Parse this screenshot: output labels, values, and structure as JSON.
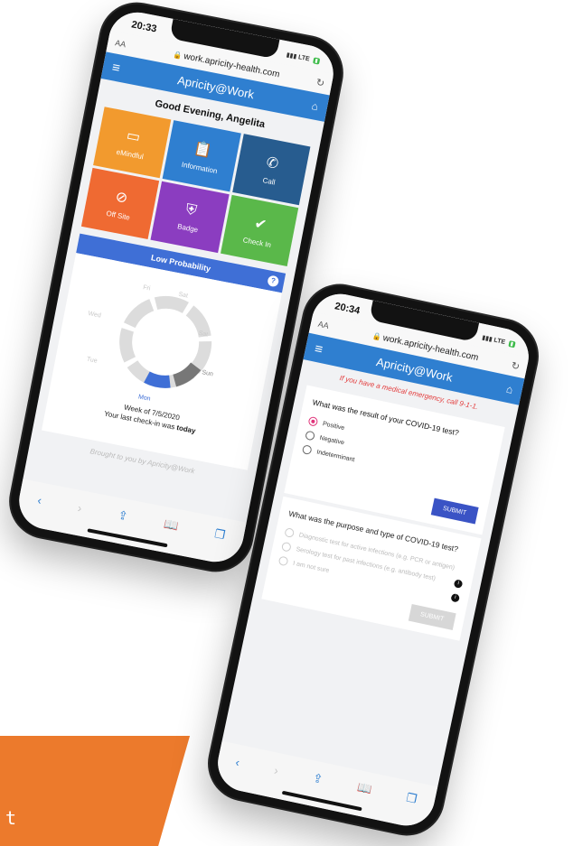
{
  "banner": {
    "text": "t"
  },
  "phone1": {
    "status": {
      "time": "20:33",
      "network": "LTE"
    },
    "browser": {
      "aa": "AA",
      "url": "work.apricity-health.com"
    },
    "app": {
      "title": "Apricity@Work"
    },
    "greeting": "Good Evening, Angelita",
    "tiles": [
      {
        "label": "eMindful",
        "icon": "emindful-icon",
        "color": "#f29a2e"
      },
      {
        "label": "Information",
        "icon": "clipboard-icon",
        "color": "#2f7fd0"
      },
      {
        "label": "Call",
        "icon": "phone-icon",
        "color": "#275c8f"
      },
      {
        "label": "Off Site",
        "icon": "no-building-icon",
        "color": "#ef6a32"
      },
      {
        "label": "Badge",
        "icon": "shield-icon",
        "color": "#8b3dc0"
      },
      {
        "label": "Check In",
        "icon": "check-shield-icon",
        "color": "#5ab84a"
      }
    ],
    "probability": "Low Probability",
    "days": {
      "sat": "Sat",
      "sun": "Sun",
      "mon": "Mon",
      "tue": "Tue",
      "wed": "Wed",
      "thu": "Thu",
      "fri": "Fri"
    },
    "week_of": "Week of 7/5/2020",
    "last_checkin_prefix": "Your last check-in was ",
    "last_checkin_value": "today",
    "brought": "Brought to you by Apricity@Work"
  },
  "phone2": {
    "status": {
      "time": "20:34",
      "network": "LTE"
    },
    "browser": {
      "aa": "AA",
      "url": "work.apricity-health.com"
    },
    "app": {
      "title": "Apricity@Work"
    },
    "emergency": "If you have a medical emergency, call 9-1-1.",
    "q1": {
      "title": "What was the result of your COVID-19 test?",
      "options": [
        "Positive",
        "Negative",
        "Indeterminant"
      ],
      "selected": "Positive",
      "submit": "SUBMIT"
    },
    "q2": {
      "title": "What was the purpose and type of COVID-19 test?",
      "options": [
        "Diagnostic test for active infections (e.g. PCR or antigen)",
        "Serology test for past infections (e.g. antibody test)",
        "I am not sure"
      ],
      "submit": "SUBMIT"
    }
  }
}
